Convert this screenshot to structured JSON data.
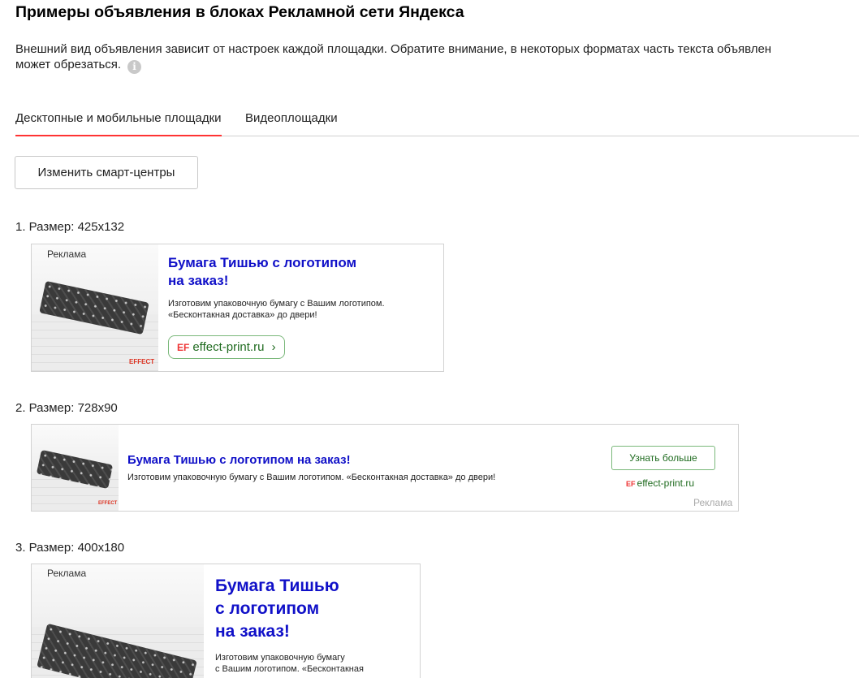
{
  "header": {
    "title": "Примеры объявления в блоках Рекламной сети Яндекса",
    "description_line1": "Внешний вид объявления зависит от настроек каждой площадки. Обратите внимание, в некоторых форматах часть текста объявлен",
    "description_line2": "может обрезаться.",
    "info_icon": "i"
  },
  "tabs": [
    {
      "label": "Десктопные и мобильные площадки",
      "active": true
    },
    {
      "label": "Видеоплощадки",
      "active": false
    }
  ],
  "smart_centers_button": "Изменить смарт-центры",
  "ads": [
    {
      "size_label": "1. Размер: 425х132",
      "reklama": "Реклама",
      "title_line1": "Бумага Тишью с логотипом",
      "title_line2": "на заказ!",
      "text_line1": "Изготовим упаковочную бумагу с Вашим логотипом.",
      "text_line2": "«Бесконтакная доставка» до двери!",
      "domain": "effect-print.ru",
      "domain_arrow": "›",
      "logo_text": "EFFECT"
    },
    {
      "size_label": "2. Размер: 728х90",
      "title": "Бумага Тишью с логотипом на заказ!",
      "text": "Изготовим упаковочную бумагу с Вашим логотипом. «Бесконтакная доставка» до двери!",
      "learn_more": "Узнать больше",
      "domain": "effect-print.ru",
      "reklama": "Реклама",
      "logo_text": "EFFECT"
    },
    {
      "size_label": "3. Размер: 400х180",
      "reklama": "Реклама",
      "title_line1": "Бумага Тишью",
      "title_line2": "с логотипом",
      "title_line3": "на заказ!",
      "text_line1": "Изготовим упаковочную бумагу",
      "text_line2": "с Вашим логотипом. «Бесконтакная"
    }
  ],
  "ef_mark": "EF",
  "colors": {
    "accent_tab": "#ff3333",
    "ad_title": "#1010c8",
    "domain_green": "#1f6b1f"
  }
}
